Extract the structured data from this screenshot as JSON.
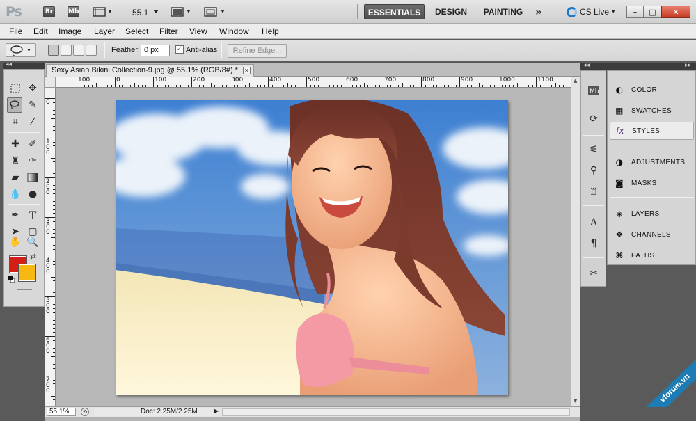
{
  "app": {
    "logo": "Ps",
    "bridge": "Br",
    "minibridge": "Mb",
    "zoom": "55.1"
  },
  "workspaces": [
    {
      "label": "ESSENTIALS",
      "active": true
    },
    {
      "label": "DESIGN",
      "active": false
    },
    {
      "label": "PAINTING",
      "active": false
    }
  ],
  "more_workspaces": "»",
  "cslive": {
    "label": "CS Live"
  },
  "window_buttons": {
    "minimize": "–",
    "restore": "□",
    "close": "✕"
  },
  "menu": [
    "File",
    "Edit",
    "Image",
    "Layer",
    "Select",
    "Filter",
    "View",
    "Window",
    "Help"
  ],
  "options": {
    "feather_label": "Feather:",
    "feather_value": "0 px",
    "antialias_label": "Anti-alias",
    "antialias_checked": true,
    "refine_edge": "Refine Edge..."
  },
  "document": {
    "tab_title": "Sexy Asian Bikini Collection-9.jpg @ 55.1% (RGB/8#) *",
    "h_ruler": [
      "100",
      "0",
      "100",
      "200",
      "300",
      "400",
      "500",
      "600",
      "700",
      "800",
      "900",
      "1000",
      "1100"
    ],
    "v_ruler": [
      "0",
      "1 0 0",
      "2 0 0",
      "3 0 0",
      "4 0 0",
      "5 0 0",
      "6 0 0",
      "7 0 0"
    ],
    "status_zoom": "55.1%",
    "status_doc": "Doc: 2.25M/2.25M"
  },
  "colors": {
    "foreground": "#d41f17",
    "background": "#f6b811"
  },
  "panels": [
    {
      "label": "COLOR",
      "icon": "color-wheel-icon",
      "active": false
    },
    {
      "label": "SWATCHES",
      "icon": "swatches-grid-icon",
      "active": false
    },
    {
      "label": "STYLES",
      "icon": "styles-fx-icon",
      "active": true
    },
    {
      "label": "ADJUSTMENTS",
      "icon": "adjustments-icon",
      "active": false
    },
    {
      "label": "MASKS",
      "icon": "mask-icon",
      "active": false
    },
    {
      "label": "LAYERS",
      "icon": "layers-icon",
      "active": false
    },
    {
      "label": "CHANNELS",
      "icon": "channels-icon",
      "active": false
    },
    {
      "label": "PATHS",
      "icon": "paths-icon",
      "active": false
    }
  ],
  "watermark": "vforum.vn"
}
